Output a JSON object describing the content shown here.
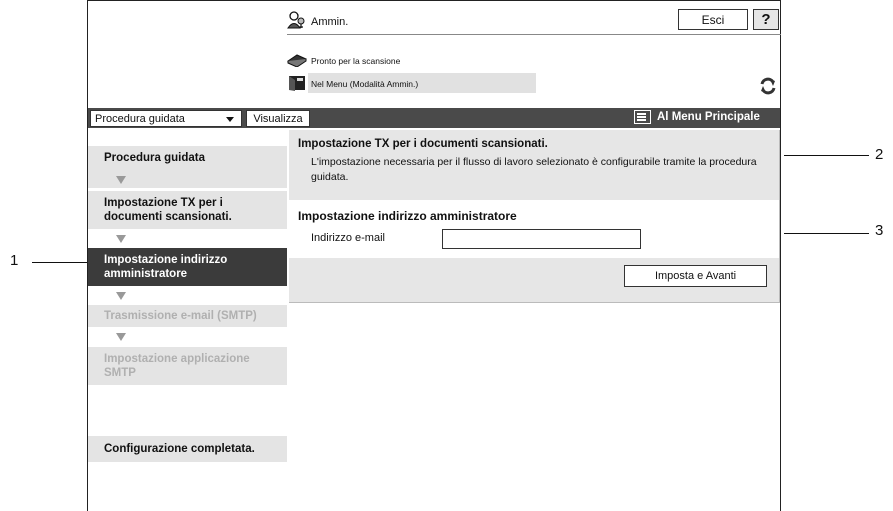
{
  "header": {
    "user_label": "Ammin.",
    "exit_label": "Esci",
    "help_label": "?",
    "status_ready": "Pronto per la scansione",
    "status_menu": "Nel Menu (Modalità Ammin.)"
  },
  "toolbar": {
    "selected_option": "Procedura guidata",
    "view_label": "Visualizza",
    "main_menu_label": "Al Menu Principale"
  },
  "sidebar": {
    "items": [
      {
        "label": "Procedura guidata",
        "state": "done"
      },
      {
        "label": "Impostazione TX per i documenti scansionati.",
        "state": "done"
      },
      {
        "label": "Impostazione indirizzo amministratore",
        "state": "active"
      },
      {
        "label": "Trasmissione e-mail (SMTP)",
        "state": "disabled"
      },
      {
        "label": "Impostazione applicazione SMTP",
        "state": "disabled"
      },
      {
        "label": "Configurazione completata.",
        "state": "done"
      }
    ]
  },
  "main": {
    "panel_title": "Impostazione TX per i documenti scansionati.",
    "panel_desc": "L'impostazione necessaria per il flusso di lavoro selezionato è configurabile tramite la procedura guidata.",
    "section_title": "Impostazione indirizzo amministratore",
    "email_label": "Indirizzo e-mail",
    "email_value": "",
    "submit_label": "Imposta e Avanti"
  },
  "callouts": [
    "1",
    "2",
    "3"
  ],
  "colors": {
    "toolbar_bg": "#4a4a4a",
    "active_item_bg": "#3b3b3b",
    "light_panel_bg": "#e6e6e6",
    "disabled_text": "#b0b0b0"
  }
}
